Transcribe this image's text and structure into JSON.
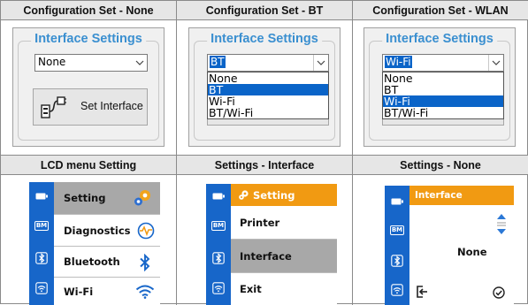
{
  "headers": {
    "top": [
      "Configuration Set - None",
      "Configuration Set - BT",
      "Configuration Set - WLAN"
    ],
    "bottom": [
      "LCD menu Setting",
      "Settings - Interface",
      "Settings - None"
    ]
  },
  "panels": [
    {
      "group_title": "Interface Settings",
      "combo_value": "None",
      "button_label": "Set Interface"
    },
    {
      "group_title": "Interface Settings",
      "combo_value": "BT",
      "options": [
        "None",
        "BT",
        "Wi-Fi",
        "BT/Wi-Fi"
      ],
      "highlighted": "BT"
    },
    {
      "group_title": "Interface Settings",
      "combo_value": "Wi-Fi",
      "options": [
        "None",
        "BT",
        "Wi-Fi",
        "BT/Wi-Fi"
      ],
      "highlighted": "Wi-Fi"
    }
  ],
  "lcd_menu": {
    "items": [
      "Setting",
      "Diagnostics",
      "Bluetooth",
      "Wi-Fi"
    ],
    "icons": [
      "gear-icon",
      "diagnostics-icon",
      "bluetooth-icon",
      "wifi-icon"
    ]
  },
  "lcd_settings": {
    "title": "Setting",
    "items": [
      "Printer",
      "Interface",
      "Exit"
    ],
    "selected": "Interface"
  },
  "lcd_none": {
    "title": "Interface",
    "value": "None"
  },
  "sidebar_icons": [
    "battery-icon",
    "bm-icon",
    "bluetooth-icon",
    "wifi-icon"
  ],
  "sidebar_bm_label": "BM",
  "colors": {
    "lcd_blue": "#1766c9",
    "lcd_orange": "#f19a12",
    "group_title": "#3a8fd0",
    "selection_blue": "#0a64c8"
  }
}
